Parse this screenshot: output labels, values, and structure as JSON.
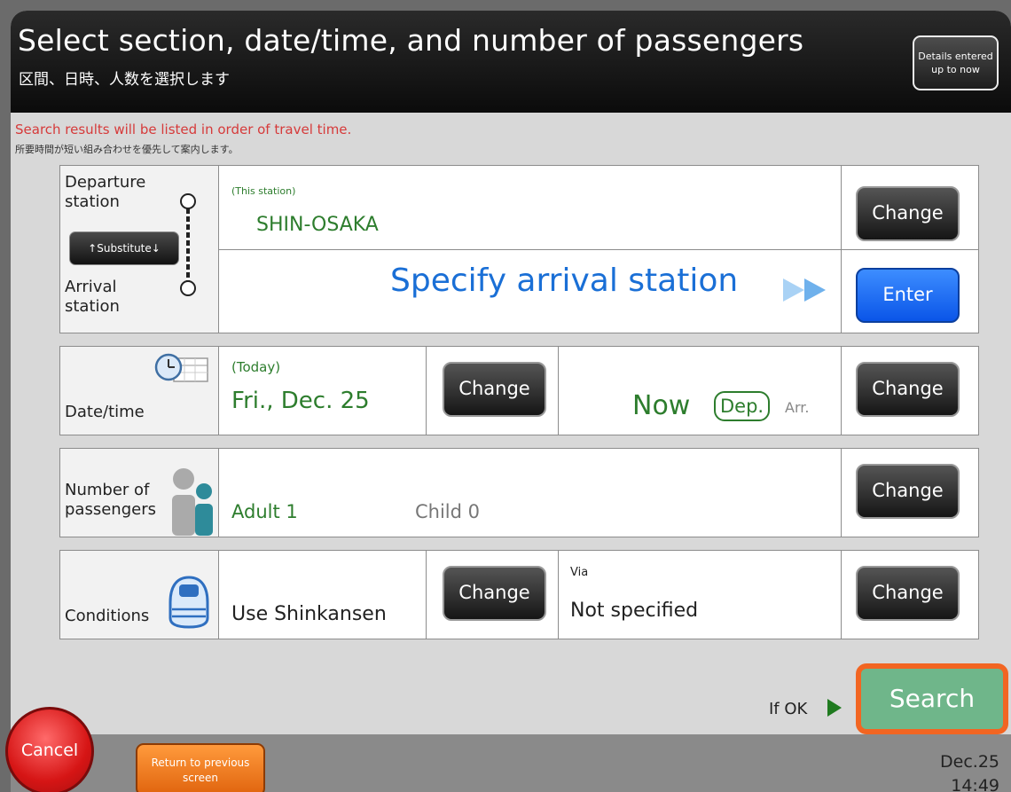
{
  "header": {
    "title_en": "Select section, date/time, and number of passengers",
    "title_jp": "区間、日時、人数を選択します",
    "details_button": "Details entered up to now"
  },
  "notice": {
    "en": "Search results will be listed in order of travel time.",
    "jp": "所要時間が短い組み合わせを優先して案内します。"
  },
  "section": {
    "departure_label": "Departure station",
    "arrival_label": "Arrival station",
    "substitute_label": "↑Substitute↓",
    "departure_note": "(This station)",
    "departure_value": "SHIN-OSAKA",
    "arrival_prompt": "Specify arrival station",
    "change_label": "Change",
    "enter_label": "Enter"
  },
  "datetime": {
    "label": "Date/time",
    "date_note": "(Today)",
    "date_value": "Fri., Dec. 25",
    "time_value": "Now",
    "dep_label": "Dep.",
    "arr_label": "Arr.",
    "change_label": "Change"
  },
  "passengers": {
    "label": "Number of passengers",
    "adult": "Adult 1",
    "child": "Child 0",
    "change_label": "Change"
  },
  "conditions": {
    "label": "Conditions",
    "value": "Use Shinkansen",
    "via_label": "Via",
    "via_value": "Not specified",
    "change_label": "Change"
  },
  "footer": {
    "cancel": "Cancel",
    "return": "Return to previous screen",
    "if_ok": "If OK",
    "search": "Search",
    "date": "Dec.25",
    "time": "14:49"
  },
  "colors": {
    "accent_green": "#2d7d2d",
    "link_blue": "#1a6fd6",
    "search_green": "#6fb68a",
    "highlight_orange": "#f26522"
  }
}
